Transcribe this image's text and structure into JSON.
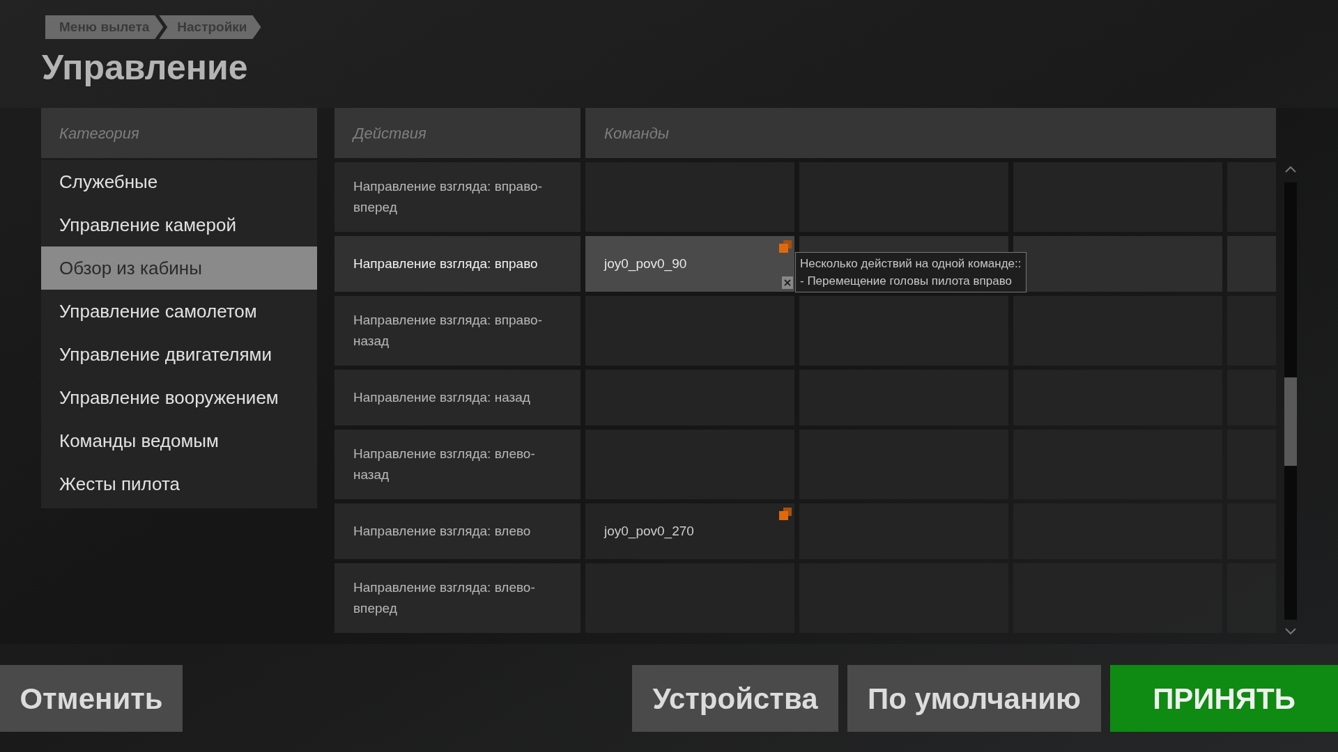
{
  "breadcrumb": [
    {
      "label": "Меню вылета"
    },
    {
      "label": "Настройки"
    }
  ],
  "title": "Управление",
  "categories": {
    "header": "Категория",
    "items": [
      {
        "label": "Служебные",
        "selected": false
      },
      {
        "label": "Управление камерой",
        "selected": false
      },
      {
        "label": "Обзор из кабины",
        "selected": true
      },
      {
        "label": "Управление самолетом",
        "selected": false
      },
      {
        "label": "Управление двигателями",
        "selected": false
      },
      {
        "label": "Управление вооружением",
        "selected": false
      },
      {
        "label": "Команды ведомым",
        "selected": false
      },
      {
        "label": "Жесты пилота",
        "selected": false
      }
    ]
  },
  "bindings": {
    "actions_header": "Действия",
    "commands_header": "Команды",
    "rows": [
      {
        "action": "Направление взгляда: вправо-вперед",
        "selected": false,
        "commands": []
      },
      {
        "action": "Направление взгляда: вправо",
        "selected": true,
        "commands": [
          {
            "text": "joy0_pov0_90",
            "conflict": true,
            "selected": true
          }
        ]
      },
      {
        "action": "Направление взгляда: вправо-назад",
        "selected": false,
        "commands": []
      },
      {
        "action": "Направление взгляда: назад",
        "selected": false,
        "commands": []
      },
      {
        "action": "Направление взгляда: влево-назад",
        "selected": false,
        "commands": []
      },
      {
        "action": "Направление взгляда: влево",
        "selected": false,
        "commands": [
          {
            "text": "joy0_pov0_270",
            "conflict": true,
            "selected": false
          }
        ]
      },
      {
        "action": "Направление взгляда: влево-вперед",
        "selected": false,
        "commands": []
      }
    ]
  },
  "tooltip": {
    "lines": [
      "Несколько действий на одной команде::",
      "- Перемещение головы пилота вправо"
    ]
  },
  "buttons": {
    "cancel": "Отменить",
    "devices": "Устройства",
    "defaults": "По умолчанию",
    "accept": "ПРИНЯТЬ"
  }
}
